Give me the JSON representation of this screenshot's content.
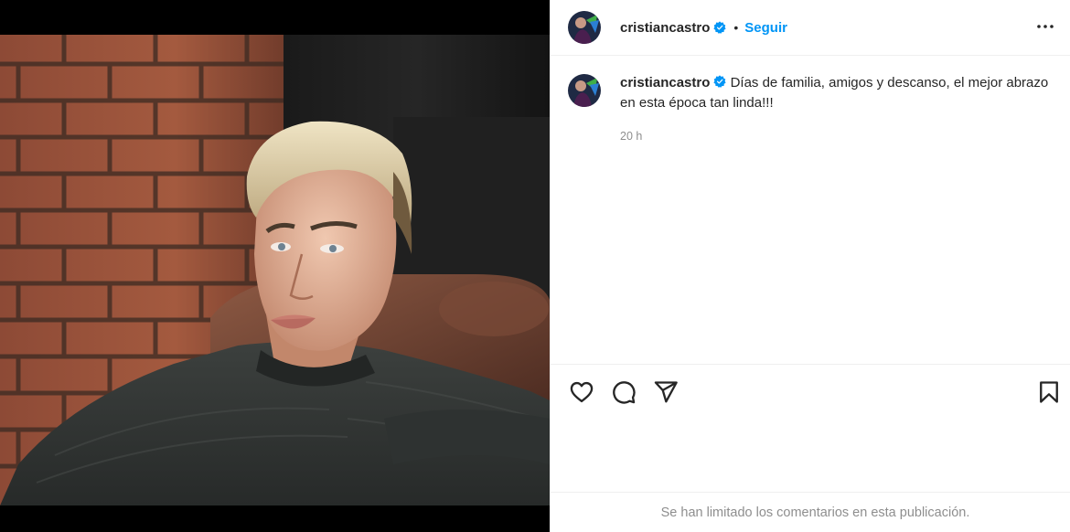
{
  "post": {
    "username": "cristiancastro",
    "follow_label": "Seguir",
    "separator": "•",
    "caption": "Días de familia, amigos y descanso, el mejor abrazo en esta época tan linda!!!",
    "time_ago": "20 h",
    "comments_limited": "Se han limitado los comentarios en esta publicación."
  },
  "icons": {
    "verified": "verified-badge-icon",
    "more": "more-options-icon",
    "like": "heart-icon",
    "comment": "comment-icon",
    "share": "share-icon",
    "save": "bookmark-icon"
  },
  "colors": {
    "accent": "#0095f6",
    "text": "#262626",
    "muted": "#8e8e8e"
  }
}
